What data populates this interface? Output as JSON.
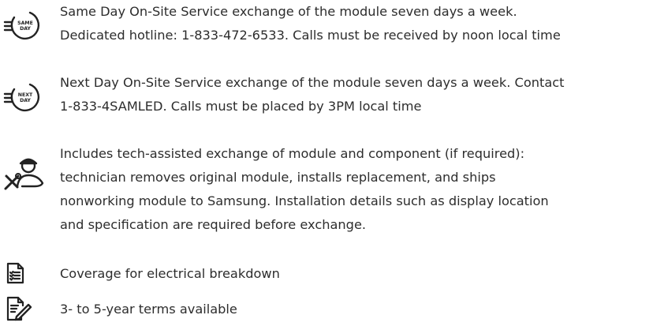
{
  "features": [
    {
      "icon": "same-day-clock-icon",
      "icon_label": [
        "SAME",
        "DAY"
      ],
      "lines": [
        "Same Day On-Site Service exchange of the module seven days a week.",
        "Dedicated hotline: 1-833-472-6533. Calls must be received by noon local time"
      ]
    },
    {
      "icon": "next-day-clock-icon",
      "icon_label": [
        "NEXT",
        "DAY"
      ],
      "lines": [
        "Next Day On-Site Service exchange of the module seven days a week. Contact",
        "1-833-4SAMLED. Calls must be placed by 3PM local time"
      ]
    },
    {
      "icon": "technician-tools-icon",
      "lines": [
        "Includes tech-assisted exchange of module and component (if required):",
        "technician removes original module, installs replacement, and ships",
        "nonworking module to Samsung. Installation details such as display location",
        "and specification are required before exchange."
      ]
    },
    {
      "icon": "document-checklist-icon",
      "lines": [
        "Coverage for electrical breakdown"
      ]
    },
    {
      "icon": "document-edit-icon",
      "lines": [
        "3- to 5-year terms available"
      ]
    }
  ]
}
